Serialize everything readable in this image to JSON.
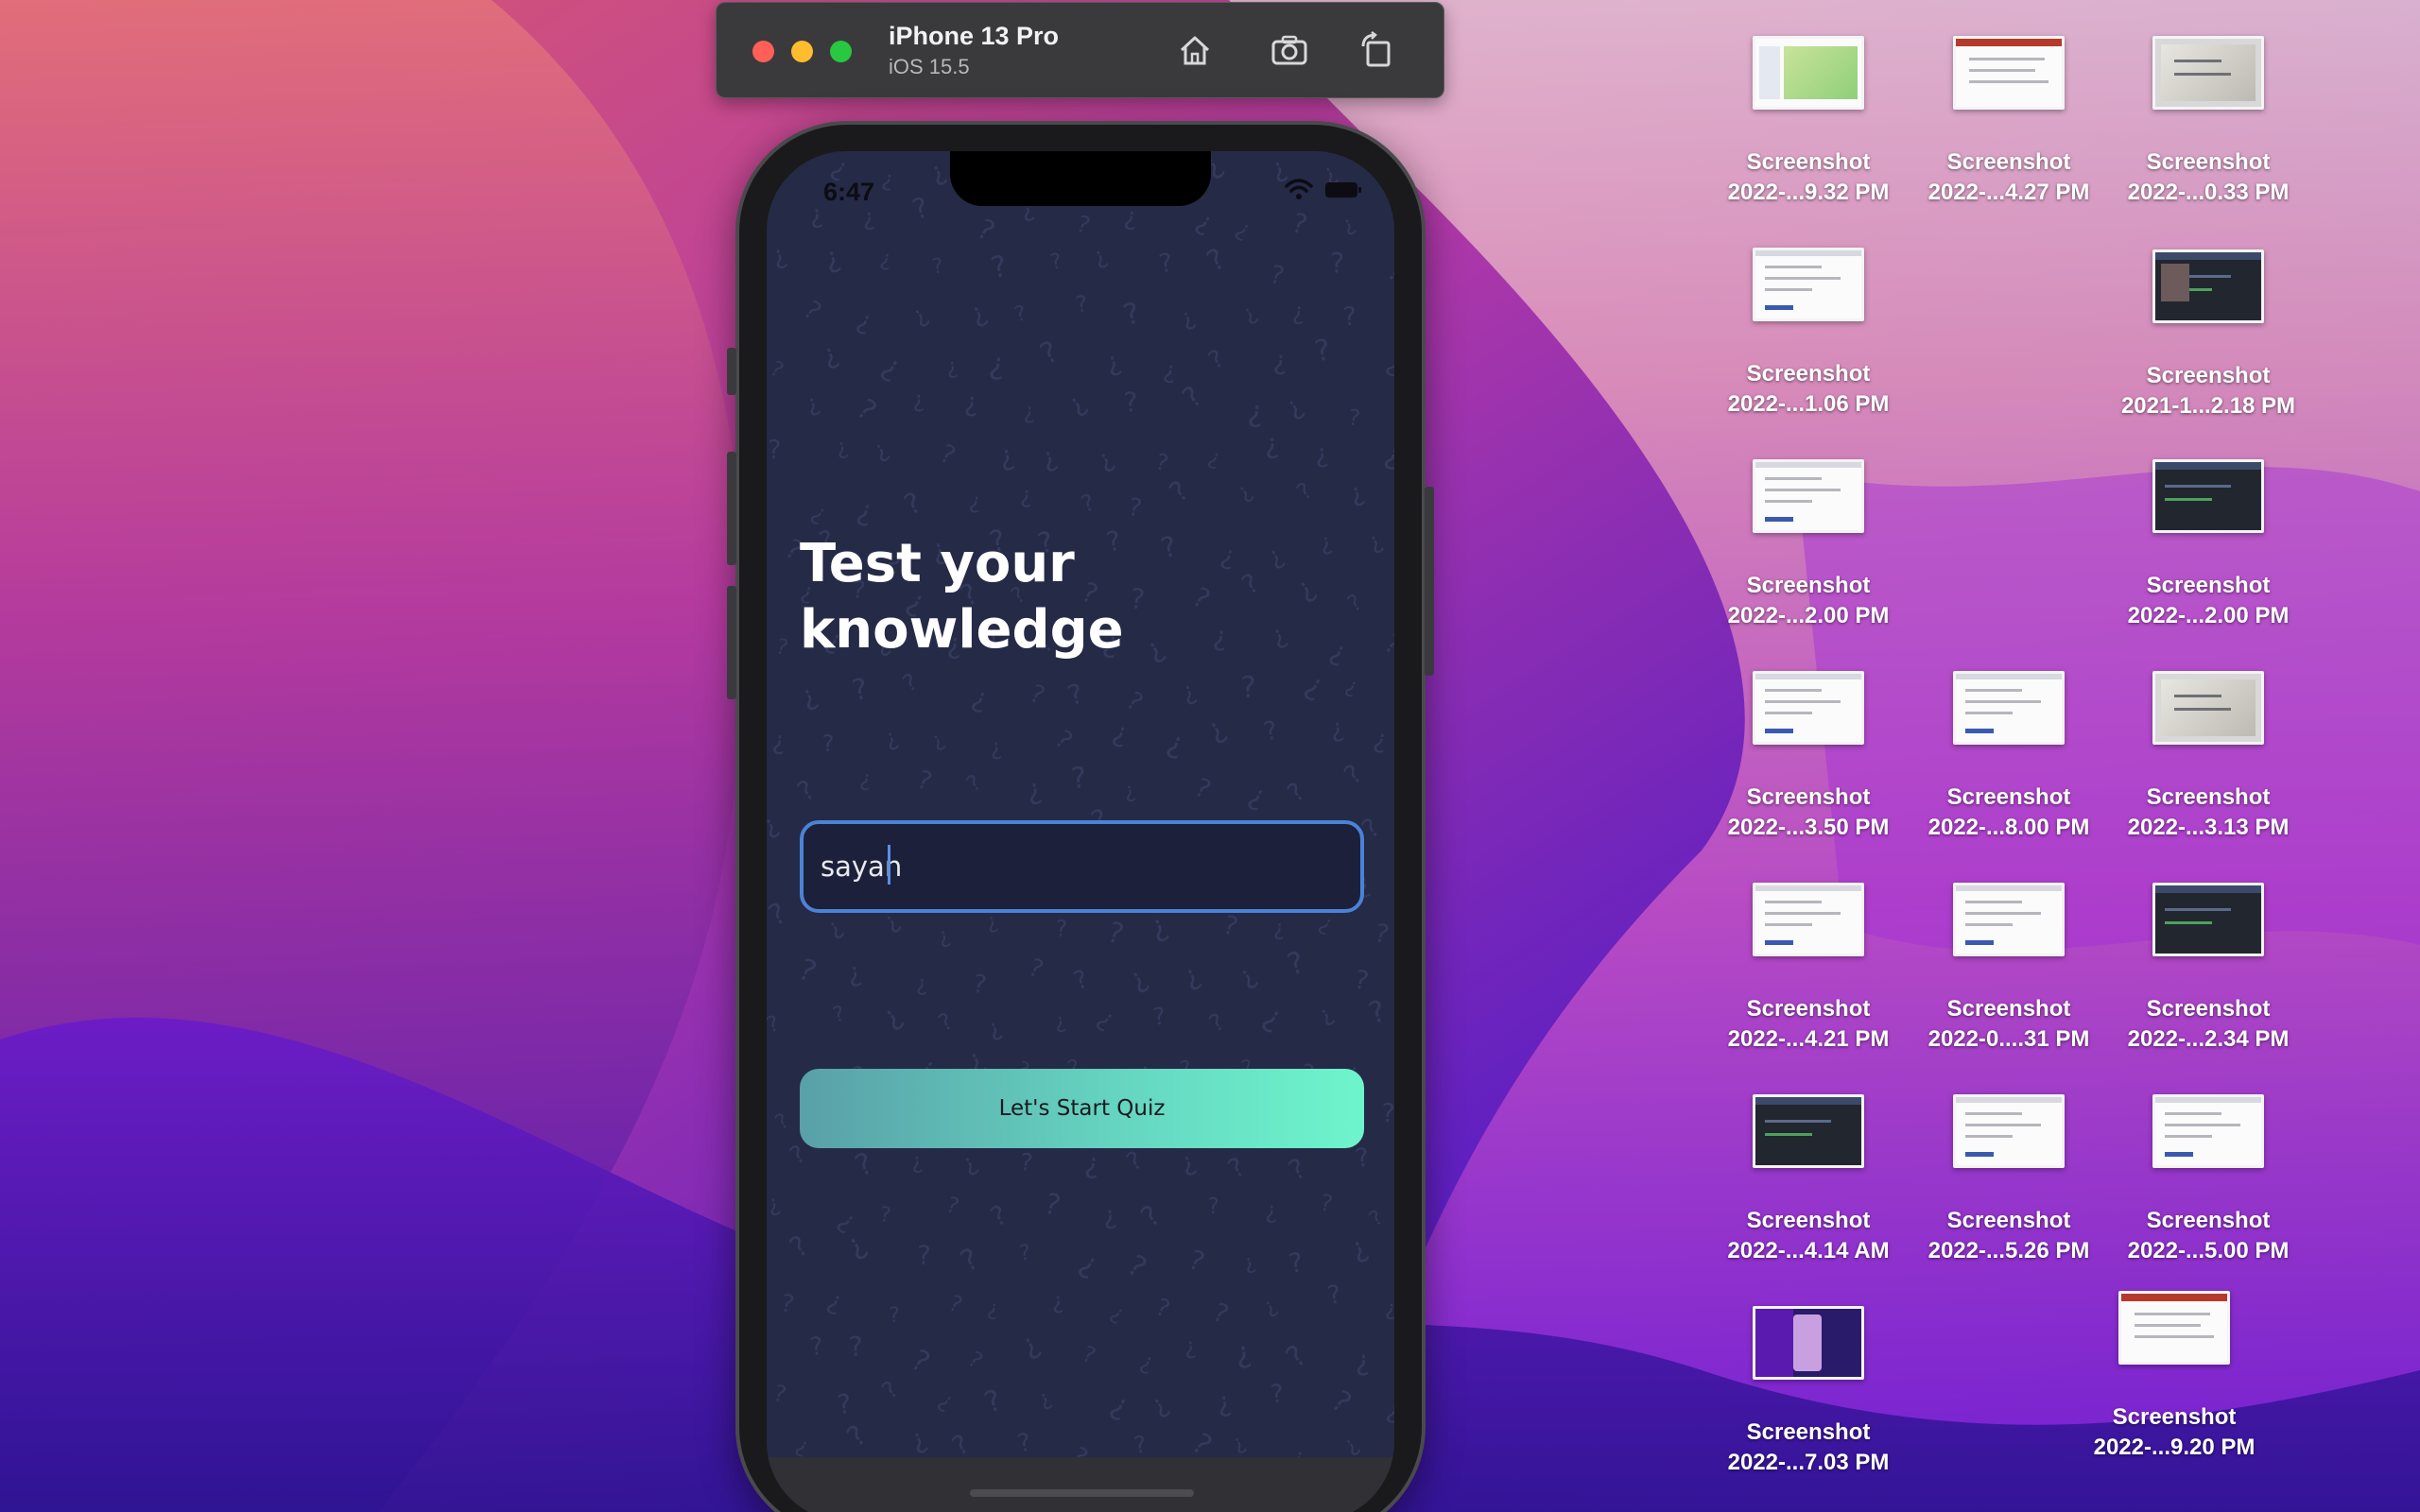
{
  "simulator": {
    "device_name": "iPhone 13 Pro",
    "os_version": "iOS 15.5",
    "toolbar_icons": [
      "home-icon",
      "screenshot-camera-icon",
      "rotate-icon"
    ]
  },
  "app": {
    "status_time": "6:47",
    "headline": "Test your knowledge",
    "name_input_value": "sayan",
    "start_button_label": "Let's Start Quiz",
    "colors": {
      "background": "#252a47",
      "input_border": "#4a83d6",
      "button_gradient_start": "#59a0a8",
      "button_gradient_end": "#6ef5cc"
    }
  },
  "desktop": {
    "icons": [
      {
        "name": "Screenshot",
        "date": "2022-...9.32 PM"
      },
      {
        "name": "Screenshot",
        "date": "2022-...4.27 PM"
      },
      {
        "name": "Screenshot",
        "date": "2022-...0.33 PM"
      },
      {
        "name": "Screenshot",
        "date": "2022-...1.06 PM"
      },
      {
        "name": "Screenshot",
        "date": "2021-1...2.18 PM"
      },
      {
        "name": "Screenshot",
        "date": "2022-...2.00 PM"
      },
      {
        "name": "Screenshot",
        "date": "2022-...2.00 PM"
      },
      {
        "name": "Screenshot",
        "date": "2022-...3.50 PM"
      },
      {
        "name": "Screenshot",
        "date": "2022-...8.00 PM"
      },
      {
        "name": "Screenshot",
        "date": "2022-...3.13 PM"
      },
      {
        "name": "Screenshot",
        "date": "2022-...4.21 PM"
      },
      {
        "name": "Screenshot",
        "date": "2022-0....31 PM"
      },
      {
        "name": "Screenshot",
        "date": "2022-...2.34 PM"
      },
      {
        "name": "Screenshot",
        "date": "2022-...4.14 AM"
      },
      {
        "name": "Screenshot",
        "date": "2022-...5.26 PM"
      },
      {
        "name": "Screenshot",
        "date": "2022-...5.00 PM"
      },
      {
        "name": "Screenshot",
        "date": "2022-...7.03 PM"
      },
      {
        "name": "Screenshot",
        "date": "2022-...9.20 PM"
      }
    ]
  }
}
